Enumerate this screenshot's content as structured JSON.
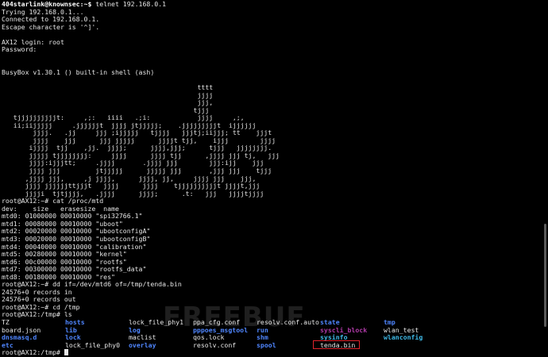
{
  "terminal": {
    "lines": [
      {
        "text": "404starlink@knownsec:~$ telnet 192.168.0.1",
        "kind": "user-prompt",
        "prompt": "404starlink@knownsec:~$",
        "cmd": " telnet 192.168.0.1"
      },
      {
        "text": "Trying 192.168.0.1...",
        "kind": "plain"
      },
      {
        "text": "Connected to 192.168.0.1.",
        "kind": "plain"
      },
      {
        "text": "Escape character is '^]'.",
        "kind": "plain"
      },
      {
        "text": "",
        "kind": "plain"
      },
      {
        "text": "AX12 login: root",
        "kind": "plain"
      },
      {
        "text": "Password:",
        "kind": "plain"
      },
      {
        "text": "",
        "kind": "plain"
      },
      {
        "text": "",
        "kind": "plain"
      },
      {
        "text": "BusyBox v1.30.1 () built-in shell (ash)",
        "kind": "plain"
      },
      {
        "text": "",
        "kind": "plain"
      },
      {
        "text": "                                                  tttt",
        "kind": "plain"
      },
      {
        "text": "                                                  jjjj",
        "kind": "plain"
      },
      {
        "text": "                                                  jjj,",
        "kind": "plain"
      },
      {
        "text": "                                                 tjjj",
        "kind": "plain"
      },
      {
        "text": "   tjjjjjjjjjjt:     ,;:   iiii   .;i:            jjjj     ,;,",
        "kind": "plain"
      },
      {
        "text": "   ii;iijjjjj     .jjjjjjt  jjjj jtjjjjj;    .jjjjjjjjjt  ijjjjjj",
        "kind": "plain"
      },
      {
        "text": "        jjjj.   .jj     jjj ;ijjjjj   tjjjj   jjjtj;iijjj; tt    jjjt",
        "kind": "plain"
      },
      {
        "text": "        jjjj    jjj      jjj jjjjj      jjjjt tjj,    ijjj        jjjj",
        "kind": "plain"
      },
      {
        "text": "       ijjjj  tjj    ,jj.  jjjj;      jjjj,jjj;      tjjj   jjjjjjjj.",
        "kind": "plain"
      },
      {
        "text": "       jjjjj tjjjjjjjj:     jjjj      jjjj tjj      ,jjjj jjj tj,   jjj",
        "kind": "plain"
      },
      {
        "text": "       jjjj:ijjjtt;     .jjjj       .jjjj jjj        jjj:ijj    jjj",
        "kind": "plain"
      },
      {
        "text": "       jjjj jjj         jtjjjjj      jjjjj jjj       ,jjj jjj    tjjj",
        "kind": "plain"
      },
      {
        "text": "      ,jjjj jjj,     ,j jjjj,      jjjj, jj,     jjjj jjj    jjj,",
        "kind": "plain"
      },
      {
        "text": "      jjjj jjjjjjttjjjt   jjjj      jjjj    tjjjjjjjjjjt jjjjt,jjj",
        "kind": "plain"
      },
      {
        "text": "      jjjji  tjtjjjj,   .jjjj      jjjj;      .t:   jjj   jjjjtjjjj",
        "kind": "plain"
      },
      {
        "text": "root@AX12:~# cat /proc/mtd",
        "kind": "plain"
      },
      {
        "text": "dev:    size   erasesize  name",
        "kind": "plain"
      },
      {
        "text": "mtd0: 01000000 00010000 \"spi32766.1\"",
        "kind": "plain"
      },
      {
        "text": "mtd1: 00080000 00010000 \"uboot\"",
        "kind": "plain"
      },
      {
        "text": "mtd2: 00020000 00010000 \"ubootconfigA\"",
        "kind": "plain"
      },
      {
        "text": "mtd3: 00020000 00010000 \"ubootconfigB\"",
        "kind": "plain"
      },
      {
        "text": "mtd4: 00040000 00010000 \"calibration\"",
        "kind": "plain"
      },
      {
        "text": "mtd5: 00280000 00010000 \"kernel\"",
        "kind": "plain"
      },
      {
        "text": "mtd6: 00c00000 00010000 \"rootfs\"",
        "kind": "plain"
      },
      {
        "text": "mtd7: 00300000 00010000 \"rootfs_data\"",
        "kind": "plain"
      },
      {
        "text": "mtd8: 00180000 00010000 \"res\"",
        "kind": "plain"
      },
      {
        "text": "root@AX12:~# dd if=/dev/mtd6 of=/tmp/tenda.bin",
        "kind": "plain"
      },
      {
        "text": "24576+0 records in",
        "kind": "plain"
      },
      {
        "text": "24576+0 records out",
        "kind": "plain"
      },
      {
        "text": "root@AX12:~# cd /tmp",
        "kind": "plain"
      },
      {
        "text": "root@AX12:/tmp# ls",
        "kind": "plain"
      }
    ],
    "ls_rows": [
      [
        {
          "name": "TZ",
          "kind": "file"
        },
        {
          "name": "hosts",
          "kind": "dir"
        },
        {
          "name": "lock_file_phy1",
          "kind": "file"
        },
        {
          "name": "ppa_cfg.conf",
          "kind": "file"
        },
        {
          "name": "resolv.conf.auto",
          "kind": "file"
        },
        {
          "name": "state",
          "kind": "dir"
        },
        {
          "name": "tmp",
          "kind": "dir"
        }
      ],
      [
        {
          "name": "board.json",
          "kind": "file"
        },
        {
          "name": "lib",
          "kind": "dir"
        },
        {
          "name": "log",
          "kind": "dir"
        },
        {
          "name": "pppoes_msgtool",
          "kind": "dir"
        },
        {
          "name": "run",
          "kind": "dir"
        },
        {
          "name": "syscli_block",
          "kind": "broken"
        },
        {
          "name": "wlan_test",
          "kind": "file"
        }
      ],
      [
        {
          "name": "dnsmasq.d",
          "kind": "dir"
        },
        {
          "name": "lock",
          "kind": "dir"
        },
        {
          "name": "maclist",
          "kind": "file"
        },
        {
          "name": "qos.lock",
          "kind": "file"
        },
        {
          "name": "shm",
          "kind": "dir"
        },
        {
          "name": "sysinfo",
          "kind": "link"
        },
        {
          "name": "wlanconfig",
          "kind": "link"
        }
      ],
      [
        {
          "name": "etc",
          "kind": "dir"
        },
        {
          "name": "lock_file_phy0",
          "kind": "file"
        },
        {
          "name": "overlay",
          "kind": "dir"
        },
        {
          "name": "resolv.conf",
          "kind": "file"
        },
        {
          "name": "spool",
          "kind": "dir"
        },
        {
          "name": "tenda.bin",
          "kind": "file",
          "highlighted": true
        }
      ]
    ],
    "final_prompt": "root@AX12:/tmp# ",
    "watermark": "FREEBUF"
  },
  "colors": {
    "background": "#000000",
    "text": "#e6e6e6",
    "directory": "#4f86ff",
    "symlink": "#3fb9e6",
    "broken_symlink": "#b03aa8",
    "highlight_box": "#e0242c"
  },
  "scroll_position": 0.88
}
